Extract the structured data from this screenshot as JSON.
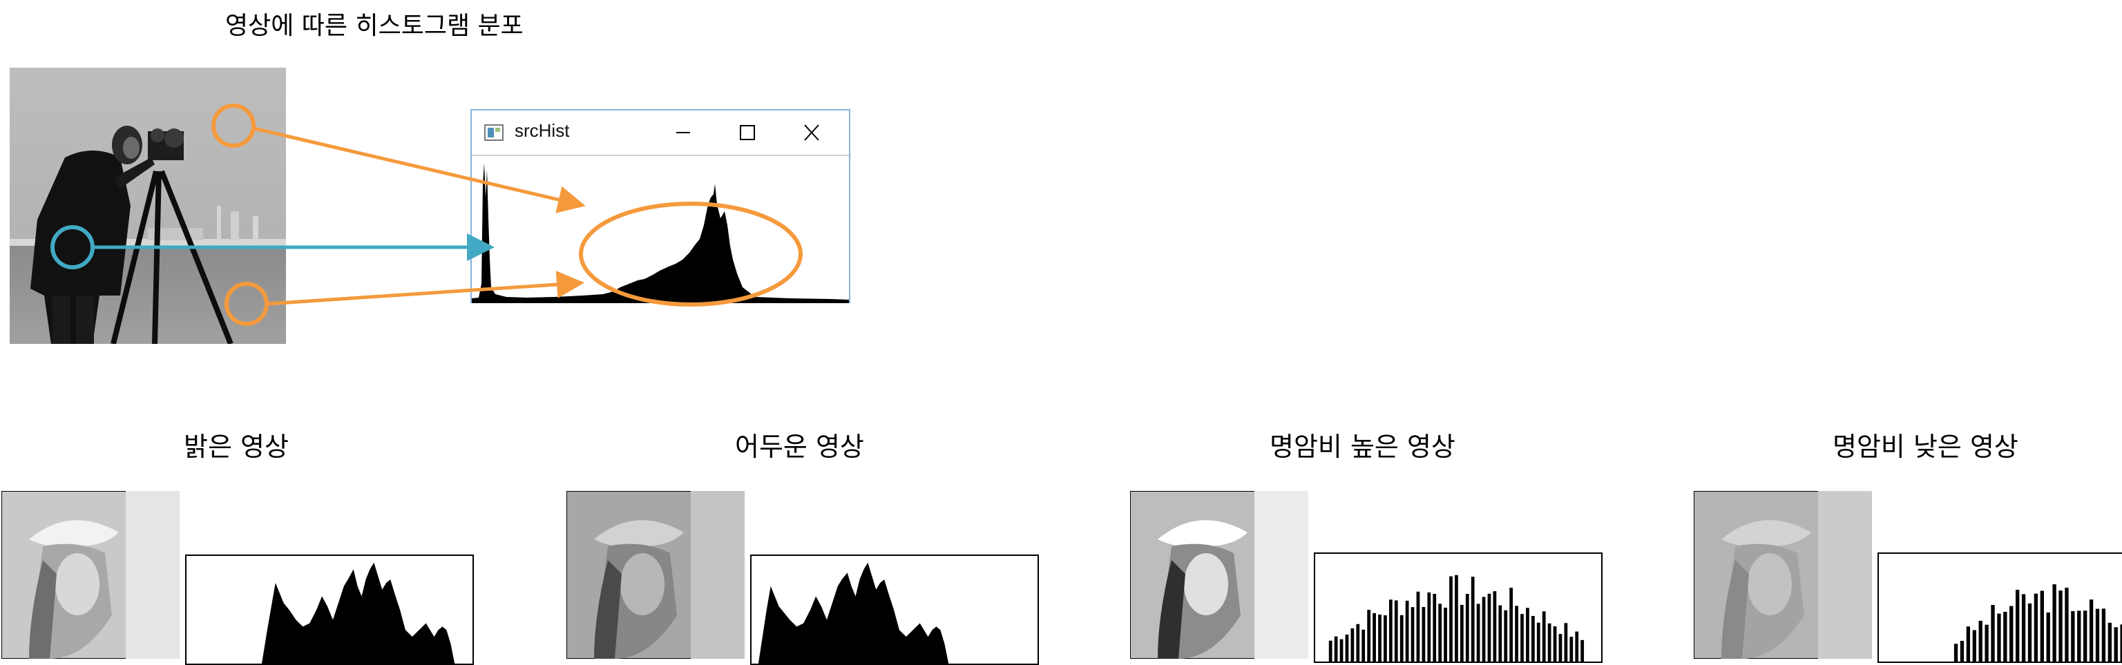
{
  "header": {
    "title": "영상에 따른 히스토그램 분포"
  },
  "window": {
    "title": "srcHist",
    "app_icon": "app-window-icon",
    "minimize_icon": "minimize-icon",
    "maximize_icon": "maximize-icon",
    "close_icon": "close-icon"
  },
  "annotation_colors": {
    "orange": "#f59a3c",
    "teal": "#41a9c3"
  },
  "panels": [
    {
      "label": "밝은 영상"
    },
    {
      "label": "어두운 영상"
    },
    {
      "label": "명암비 높은 영상"
    },
    {
      "label": "명암비 낮은 영상"
    }
  ]
}
